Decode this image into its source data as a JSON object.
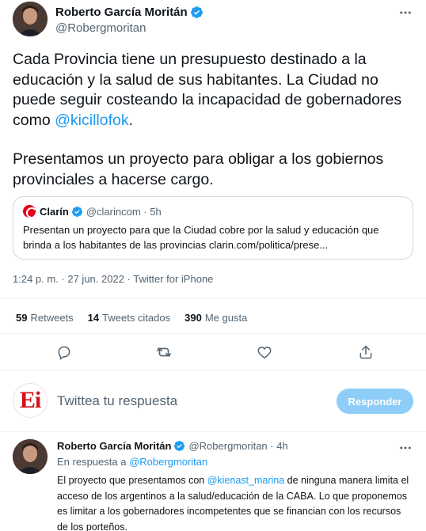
{
  "main_tweet": {
    "author_name": "Roberto García Moritán",
    "author_handle": "@Robergmoritan",
    "paragraph1_text": "Cada Provincia tiene un presupuesto destinado a la educación y la salud de sus habitantes. La Ciudad no puede seguir costeando la incapacidad de gobernadores como ",
    "paragraph1_mention": "@kicillofok",
    "paragraph1_end": ".",
    "paragraph2": "Presentamos un proyecto para obligar a los gobiernos provinciales a hacerse cargo.",
    "timestamp": "1:24 p. m. · 27 jun. 2022 · Twitter for iPhone"
  },
  "quoted_tweet": {
    "author_name": "Clarín",
    "author_handle": "@clarincom · 5h",
    "text": "Presentan un proyecto para que la Ciudad cobre por la salud y educación que brinda a los habitantes de las provincias clarin.com/politica/prese..."
  },
  "stats": {
    "retweets_count": "59",
    "retweets_label": "Retweets",
    "quotes_count": "14",
    "quotes_label": "Tweets citados",
    "likes_count": "390",
    "likes_label": "Me gusta"
  },
  "actions": {
    "reply_icon": "comment-icon",
    "retweet_icon": "retweet-icon",
    "like_icon": "heart-icon",
    "share_icon": "share-icon"
  },
  "reply_composer": {
    "avatar_text": "Ei",
    "placeholder": "Twittea tu respuesta",
    "button_label": "Responder"
  },
  "reply_tweet": {
    "author_name": "Roberto García Moritán",
    "author_handle": "@Robergmoritan · 4h",
    "replying_prefix": "En respuesta a ",
    "replying_handle": "@Robergmoritan",
    "text_start": "El proyecto que presentamos con ",
    "text_mention": "@kienast_marina",
    "text_end": " de ninguna manera limita el acceso de los argentinos a la salud/educación de la CABA. Lo que proponemos es limitar a los gobernadores incompetentes que se financian con los recursos de los porteños."
  },
  "colors": {
    "accent": "#1d9bf0",
    "secondary_text": "#536471",
    "reply_button_disabled": "#8ecdf8",
    "brand_red": "#d40f1a"
  }
}
